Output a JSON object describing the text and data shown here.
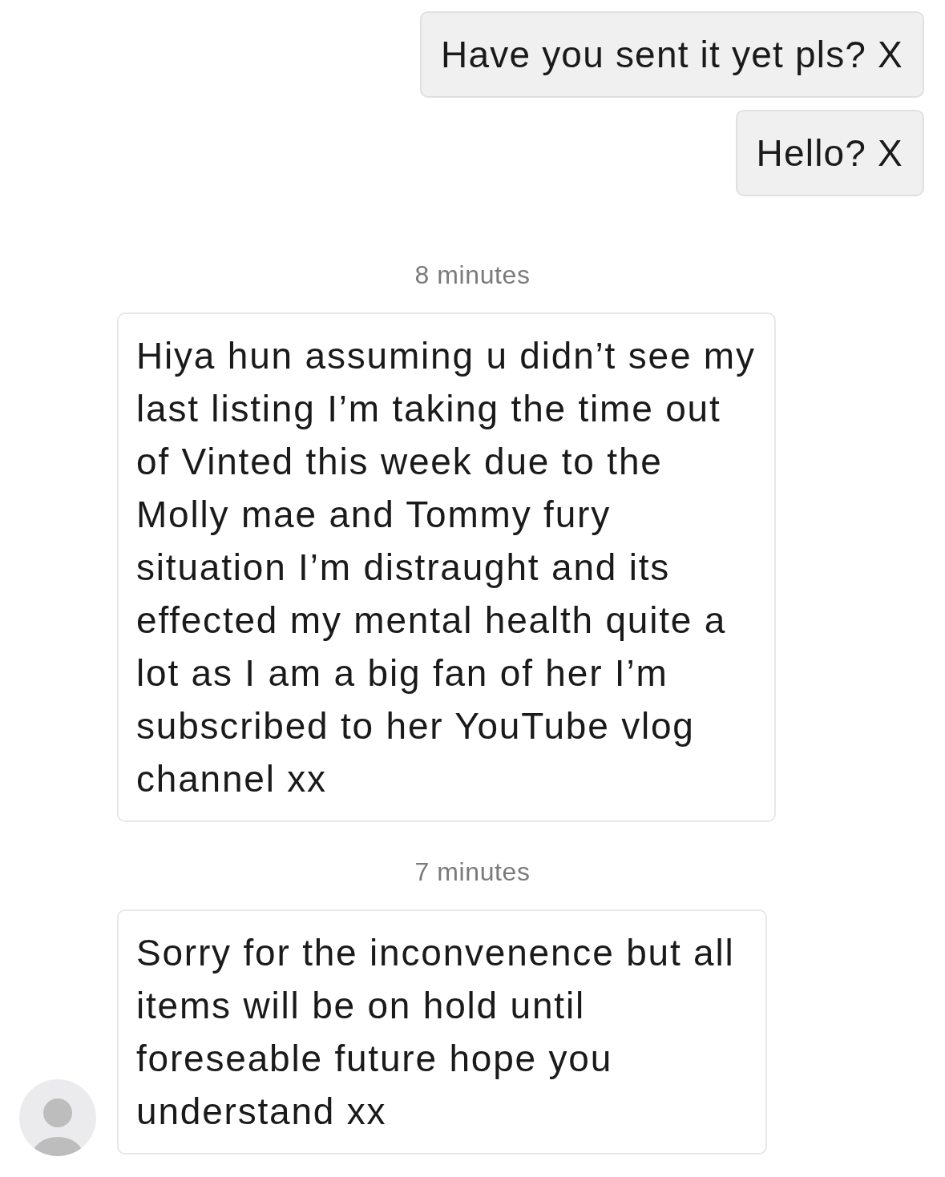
{
  "messages": [
    {
      "kind": "sent",
      "text": "Have you sent it yet pls? X"
    },
    {
      "kind": "sent",
      "text": "Hello? X"
    },
    {
      "kind": "time",
      "text": "8 minutes"
    },
    {
      "kind": "received",
      "avatar": false,
      "text": "Hiya hun assuming u didn’t see my last listing I’m taking the time out of Vinted this week due to the Molly mae and Tommy fury situation I’m distraught and its effected my mental health quite a lot as I am a big fan of her I’m subscribed to her YouTube vlog channel xx"
    },
    {
      "kind": "time",
      "text": "7 minutes"
    },
    {
      "kind": "received",
      "avatar": true,
      "text": "Sorry for the inconvenence but all items will be on hold until foreseable future hope you understand xx"
    }
  ]
}
